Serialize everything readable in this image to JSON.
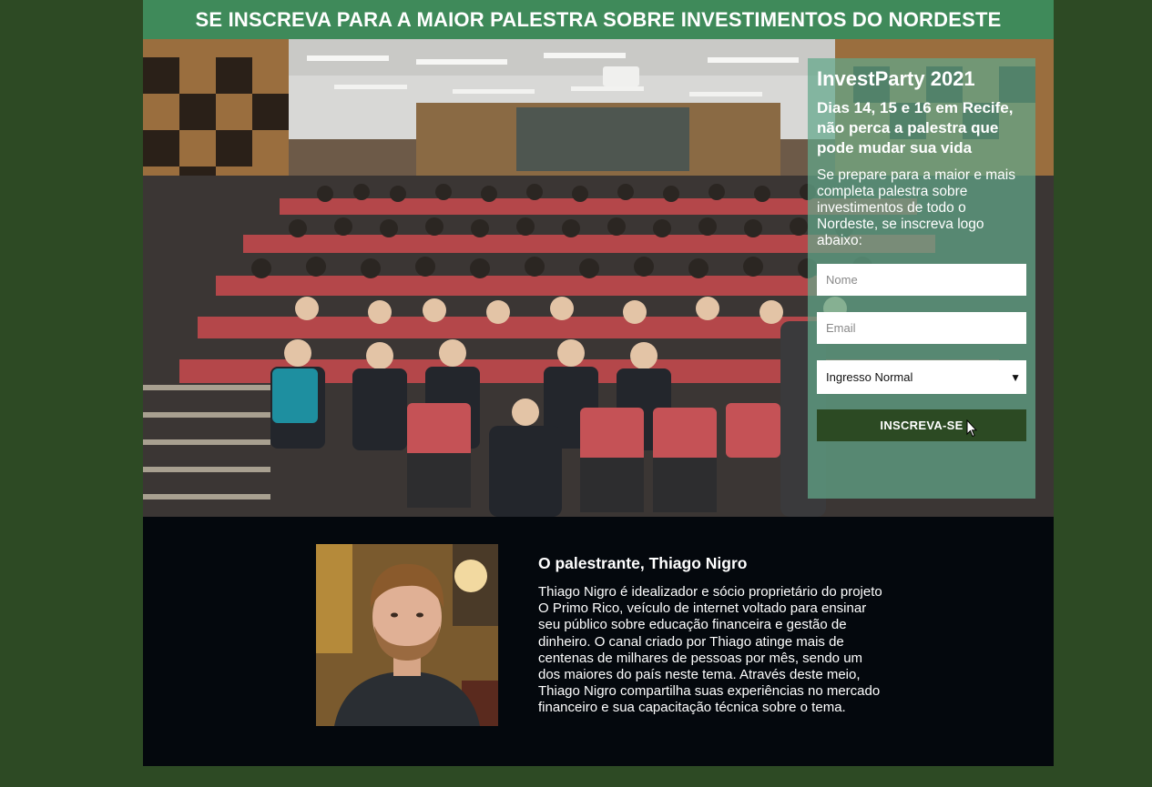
{
  "banner": {
    "title": "SE INSCREVA PARA A MAIOR PALESTRA SOBRE INVESTIMENTOS DO NORDESTE"
  },
  "hero": {
    "image_description_icon": "auditorium-photo"
  },
  "form": {
    "title": "InvestParty 2021",
    "subtitle": "Dias 14, 15 e 16 em Recife, não perca a palestra que pode mudar sua vida",
    "text": "Se prepare para a maior e mais completa palestra sobre investimentos de todo o Nordeste, se inscreva logo abaixo:",
    "name_placeholder": "Nome",
    "email_placeholder": "Email",
    "ticket_selected": "Ingresso Normal",
    "submit_label": "INSCREVA-SE"
  },
  "speaker": {
    "heading": "O palestrante, Thiago Nigro",
    "bio": "Thiago Nigro é idealizador e sócio proprietário do projeto O Primo Rico, veículo de internet voltado para ensinar seu público sobre educação financeira e gestão de dinheiro. O canal criado por Thiago atinge mais de centenas de milhares de pessoas por mês, sendo um dos maiores do país neste tema. Através deste meio, Thiago Nigro compartilha suas experiências no mercado financeiro e sua capacitação técnica sobre o tema."
  },
  "colors": {
    "page_background": "#2d4a24",
    "banner": "#3f8a5a",
    "form_panel": "#62a88a",
    "button": "#2c4a23",
    "speaker_section": "#04080d"
  }
}
